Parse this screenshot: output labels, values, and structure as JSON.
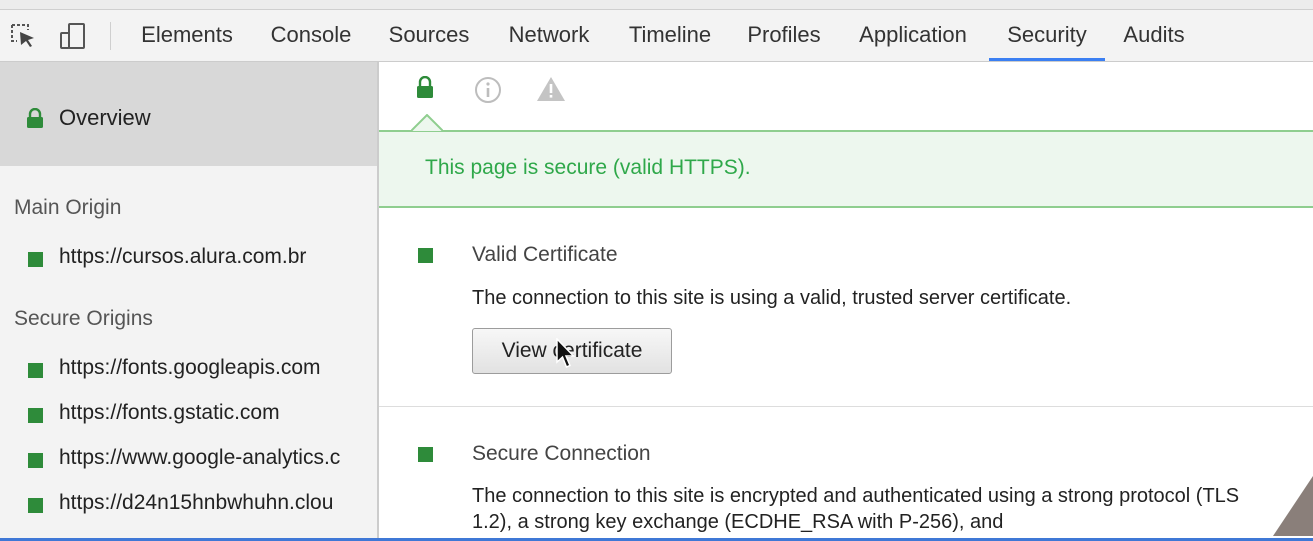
{
  "toolbar": {
    "tabs": [
      {
        "label": "Elements"
      },
      {
        "label": "Console"
      },
      {
        "label": "Sources"
      },
      {
        "label": "Network"
      },
      {
        "label": "Timeline"
      },
      {
        "label": "Profiles"
      },
      {
        "label": "Application"
      },
      {
        "label": "Security"
      },
      {
        "label": "Audits"
      }
    ],
    "active_tab": "Security",
    "accent_color": "#3b7ff2"
  },
  "sidebar": {
    "overview_label": "Overview",
    "main_origin_title": "Main Origin",
    "main_origins": [
      {
        "label": "https://cursos.alura.com.br"
      }
    ],
    "secure_origins_title": "Secure Origins",
    "secure_origins": [
      {
        "label": "https://fonts.googleapis.com"
      },
      {
        "label": "https://fonts.gstatic.com"
      },
      {
        "label": "https://www.google-analytics.c"
      },
      {
        "label": "https://d24n15hnbwhuhn.clou"
      }
    ],
    "secure_color": "#2e8b3a"
  },
  "main": {
    "summary_icons": [
      "lock-icon",
      "info-icon",
      "warning-icon"
    ],
    "banner_text": "This page is secure (valid HTTPS).",
    "banner_color": "#2fa84a",
    "certificate": {
      "title": "Valid Certificate",
      "description": "The connection to this site is using a valid, trusted server certificate.",
      "button_label": "View certificate"
    },
    "connection": {
      "title": "Secure Connection",
      "description": "The connection to this site is encrypted and authenticated using a strong protocol (TLS 1.2), a strong key exchange (ECDHE_RSA with P-256), and"
    }
  }
}
